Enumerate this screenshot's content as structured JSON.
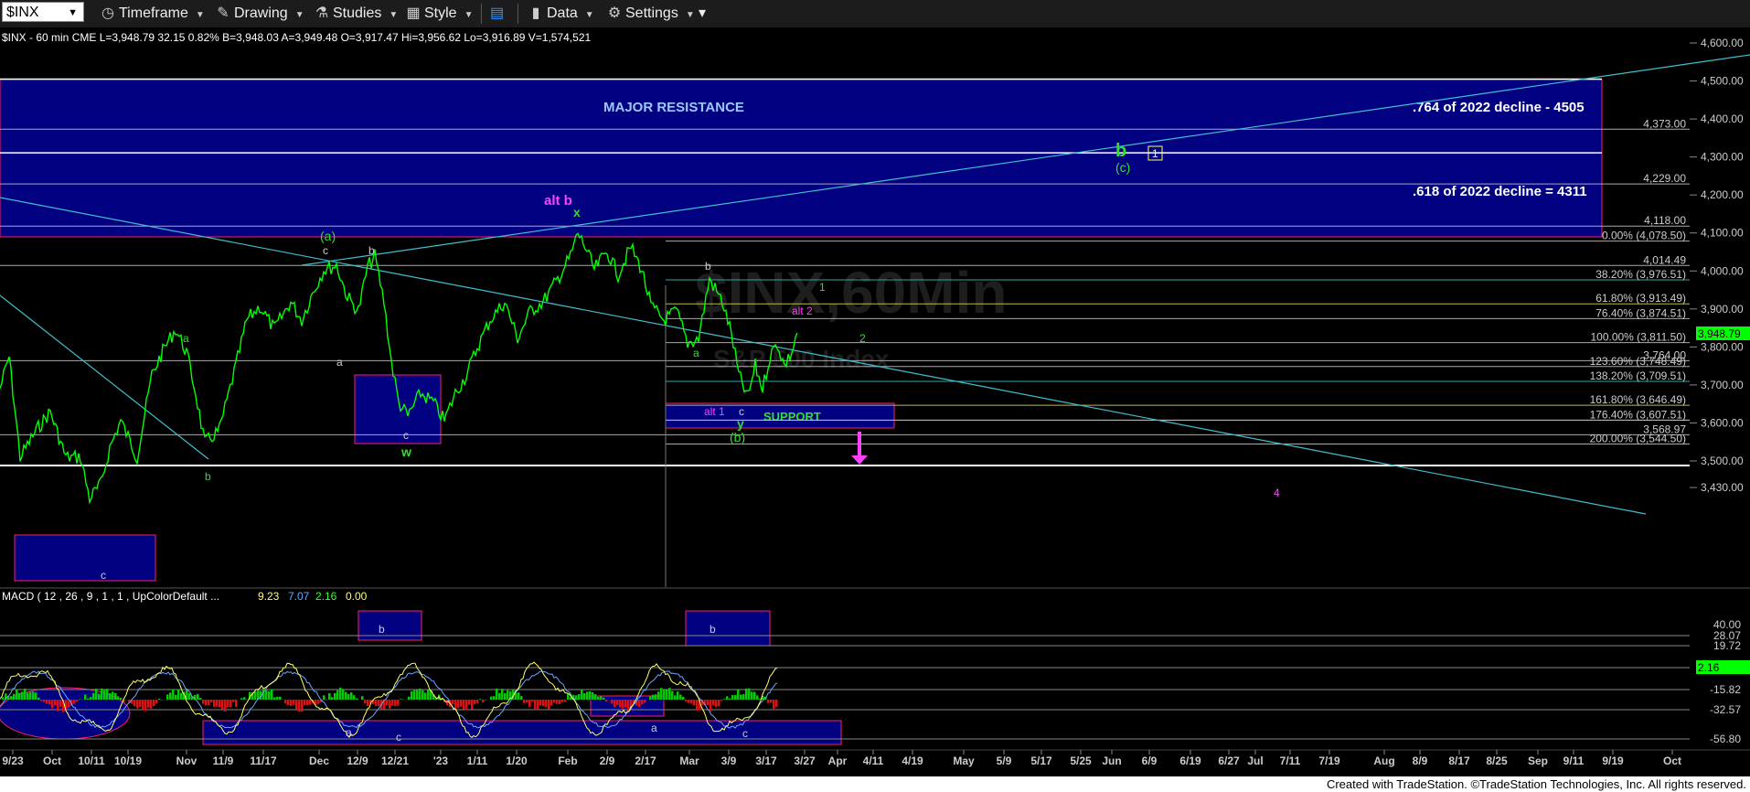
{
  "toolbar": {
    "symbol": "$INX",
    "timeframe": "Timeframe",
    "drawing": "Drawing",
    "studies": "Studies",
    "style": "Style",
    "data": "Data",
    "settings": "Settings"
  },
  "header": {
    "info": "$INX - 60 min  CME  L=3,948.79  32.15  0.82%  B=3,948.03  A=3,949.48  O=3,917.47  Hi=3,956.62  Lo=3,916.89  V=1,574,521"
  },
  "watermark": {
    "line1": "$INX,60Min",
    "line2": "S&P 500 Index"
  },
  "macd": {
    "label": "MACD ( 12 , 26 , 9 , 1 , 1 , UpColorDefault ...",
    "v1": "9.23",
    "v2": "7.07",
    "v3": "2.16",
    "v4": "0.00"
  },
  "footer": {
    "text": "Created with TradeStation. ©TradeStation Technologies, Inc. All rights reserved."
  },
  "colors": {
    "price": "#00ff00",
    "trendline": "#3fbfcf",
    "zone_fill": "#000080",
    "zone_border": "#ff2060",
    "magenta": "#ff40ff",
    "green_label": "#33dd33",
    "macd_line": "#ffff66"
  },
  "chart_data": {
    "type": "line",
    "title": "$INX - 60 min",
    "ylim": [
      3430,
      4620
    ],
    "price_ticks": [
      "4,600.00",
      "4,500.00",
      "4,400.00",
      "4,300.00",
      "4,200.00",
      "4,100.00",
      "4,000.00",
      "3,900.00",
      "3,800.00",
      "3,700.00",
      "3,600.00",
      "3,500.00",
      "3,430.00"
    ],
    "last_price": "3,948.79",
    "x_tick_labels": [
      "9/23",
      "Oct",
      "10/11",
      "10/19",
      "Nov",
      "11/9",
      "11/17",
      "Dec",
      "12/9",
      "12/21",
      "'23",
      "1/11",
      "1/20",
      "Feb",
      "2/9",
      "2/17",
      "Mar",
      "3/9",
      "3/17",
      "3/27",
      "Apr",
      "4/11",
      "4/19",
      "May",
      "5/9",
      "5/17",
      "5/25",
      "Jun",
      "6/9",
      "6/19",
      "6/27",
      "Jul",
      "7/11",
      "7/19",
      "Aug",
      "8/9",
      "8/17",
      "8/25",
      "Sep",
      "9/11",
      "9/19",
      "Oct"
    ],
    "horizontal_levels": [
      {
        "label": "4,373.00",
        "value": 4373
      },
      {
        "label": "4,229.00",
        "value": 4229
      },
      {
        "label": "4,118.00",
        "value": 4118
      },
      {
        "label": "0.00% (4,078.50)",
        "value": 4078.5
      },
      {
        "label": "4,014.49",
        "value": 4014.49
      },
      {
        "label": "38.20% (3,976.51)",
        "value": 3976.51
      },
      {
        "label": "61.80% (3,913.49)",
        "value": 3913.49
      },
      {
        "label": "76.40% (3,874.51)",
        "value": 3874.51
      },
      {
        "label": "100.00% (3,811.50)",
        "value": 3811.5
      },
      {
        "label": "3,764.00",
        "value": 3764
      },
      {
        "label": "123.60% (3,748.49)",
        "value": 3748.49
      },
      {
        "label": "138.20% (3,709.51)",
        "value": 3709.51
      },
      {
        "label": "161.80% (3,646.49)",
        "value": 3646.49
      },
      {
        "label": "176.40% (3,607.51)",
        "value": 3607.51
      },
      {
        "label": "3,568.97",
        "value": 3568.97
      },
      {
        "label": "200.00% (3,544.50)",
        "value": 3544.5
      }
    ],
    "annotations": {
      "major_resistance": "MAJOR RESISTANCE",
      "r764": ".764 of 2022 decline - 4505",
      "r618": ".618 of 2022 decline = 4311",
      "support": "SUPPORT",
      "alt_b": "alt b",
      "alt_1": "alt 1",
      "alt_2": "alt 2",
      "x": "x",
      "y": "y",
      "w": "w",
      "wave_a_paren": "(a)",
      "wave_b_paren": "(b)",
      "wave_c_paren": "(c)",
      "b_big": "b",
      "box1": "1",
      "one": "1",
      "two": "2",
      "four": "4",
      "a": "a",
      "b": "b",
      "c": "c"
    },
    "macd_ticks": [
      "40.00",
      "28.07",
      "19.72",
      "2.16",
      "-15.82",
      "-32.57",
      "-56.80"
    ]
  }
}
